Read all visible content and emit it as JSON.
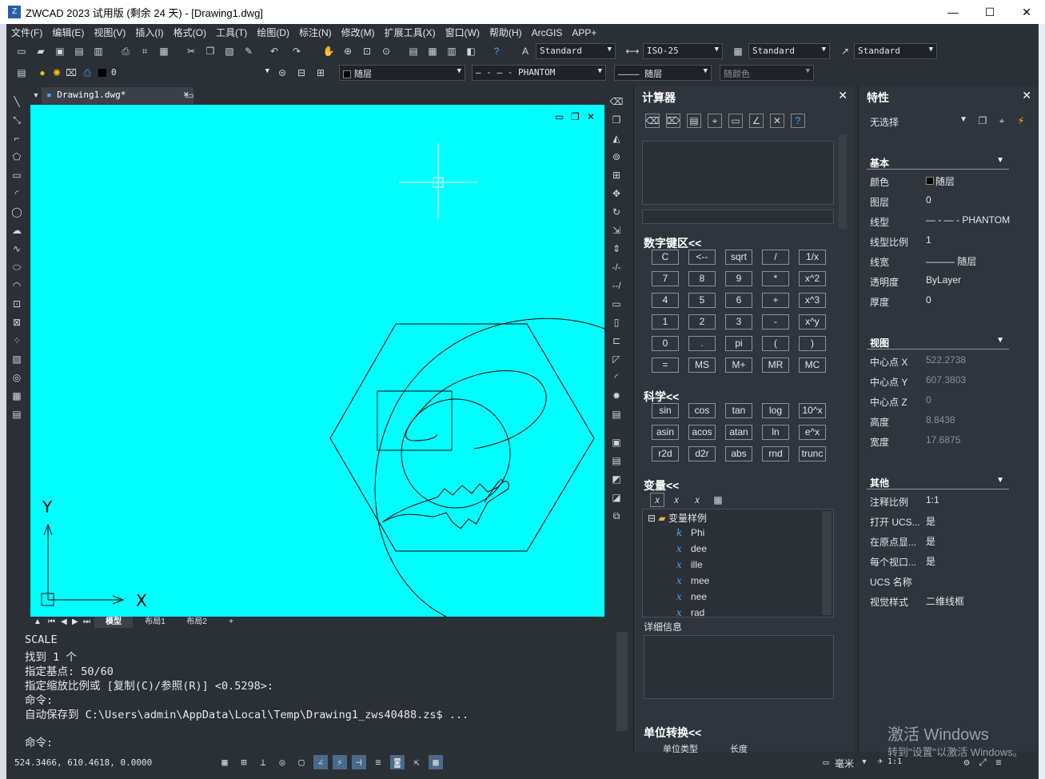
{
  "titlebar": {
    "logo": "Z",
    "title": "ZWCAD 2023 试用版 (剩余 24 天) - [Drawing1.dwg]",
    "minimize": "—",
    "maximize": "☐",
    "close": "✕"
  },
  "menu": [
    "文件(F)",
    "编辑(E)",
    "视图(V)",
    "插入(I)",
    "格式(O)",
    "工具(T)",
    "绘图(D)",
    "标注(N)",
    "修改(M)",
    "扩展工具(X)",
    "窗口(W)",
    "帮助(H)",
    "ArcGIS",
    "APP+"
  ],
  "toolbar": {
    "textstyle": "Standard",
    "dimstyle": "ISO-25",
    "tablestyle": "Standard",
    "mleaderstyle": "Standard",
    "layer": "0",
    "color": "随层",
    "linetype": "PHANTOM",
    "lineweight": "随层",
    "plotstyle": "随颜色"
  },
  "doctab": {
    "label": "Drawing1.dwg*"
  },
  "layout_tabs": [
    "模型",
    "布局1",
    "布局2",
    "+"
  ],
  "axes": {
    "y": "Y",
    "x": "X"
  },
  "command_history": [
    "SCALE",
    "找到 1 个",
    "指定基点: 50/60",
    "指定缩放比例或 [复制(C)/参照(R)] <0.5298>:",
    "命令:",
    "自动保存到 C:\\Users\\admin\\AppData\\Local\\Temp\\Drawing1_zws40488.zs$ ..."
  ],
  "command_prompt": "命令:",
  "status": {
    "coords": "524.3466, 610.4618, 0.0000",
    "units": "毫米",
    "scale": "1:1"
  },
  "calc": {
    "title": "计算器",
    "numpad_title": "数字键区<<",
    "numpad": [
      [
        "C",
        "<--",
        "sqrt",
        "/",
        "1/x"
      ],
      [
        "7",
        "8",
        "9",
        "*",
        "x^2"
      ],
      [
        "4",
        "5",
        "6",
        "+",
        "x^3"
      ],
      [
        "1",
        "2",
        "3",
        "-",
        "x^y"
      ],
      [
        "0",
        ".",
        "pi",
        "(",
        ")"
      ],
      [
        "=",
        "MS",
        "M+",
        "MR",
        "MC"
      ]
    ],
    "sci_title": "科学<<",
    "sci": [
      [
        "sin",
        "cos",
        "tan",
        "log",
        "10^x"
      ],
      [
        "asin",
        "acos",
        "atan",
        "ln",
        "e^x"
      ],
      [
        "r2d",
        "d2r",
        "abs",
        "rnd",
        "trunc"
      ]
    ],
    "var_title": "变量<<",
    "var_root": "变量样例",
    "vars": [
      {
        "t": "k",
        "n": "Phi"
      },
      {
        "t": "x",
        "n": "dee"
      },
      {
        "t": "x",
        "n": "ille"
      },
      {
        "t": "x",
        "n": "mee"
      },
      {
        "t": "x",
        "n": "nee"
      },
      {
        "t": "x",
        "n": "rad"
      }
    ],
    "details": "详细信息",
    "unit_title": "单位转换<<",
    "unit_type_label": "单位类型",
    "unit_type_value": "长度"
  },
  "props": {
    "title": "特性",
    "selection": "无选择",
    "sec_basic": "基本",
    "basic": [
      {
        "k": "颜色",
        "v": "随层"
      },
      {
        "k": "图层",
        "v": "0"
      },
      {
        "k": "线型",
        "v": "— - — - PHANTOM"
      },
      {
        "k": "线型比例",
        "v": "1"
      },
      {
        "k": "线宽",
        "v": "——— 随层"
      },
      {
        "k": "透明度",
        "v": "ByLayer"
      },
      {
        "k": "厚度",
        "v": "0"
      }
    ],
    "sec_view": "视图",
    "view": [
      {
        "k": "中心点 X",
        "v": "522.2738"
      },
      {
        "k": "中心点 Y",
        "v": "607.3803"
      },
      {
        "k": "中心点 Z",
        "v": "0"
      },
      {
        "k": "高度",
        "v": "8.8438"
      },
      {
        "k": "宽度",
        "v": "17.6875"
      }
    ],
    "sec_other": "其他",
    "other": [
      {
        "k": "注释比例",
        "v": "1:1"
      },
      {
        "k": "打开 UCS...",
        "v": "是"
      },
      {
        "k": "在原点显...",
        "v": "是"
      },
      {
        "k": "每个视口...",
        "v": "是"
      },
      {
        "k": "UCS 名称",
        "v": ""
      },
      {
        "k": "视觉样式",
        "v": "二维线框"
      }
    ]
  },
  "watermark": {
    "line1": "激活 Windows",
    "line2": "转到\"设置\"以激活 Windows。"
  }
}
